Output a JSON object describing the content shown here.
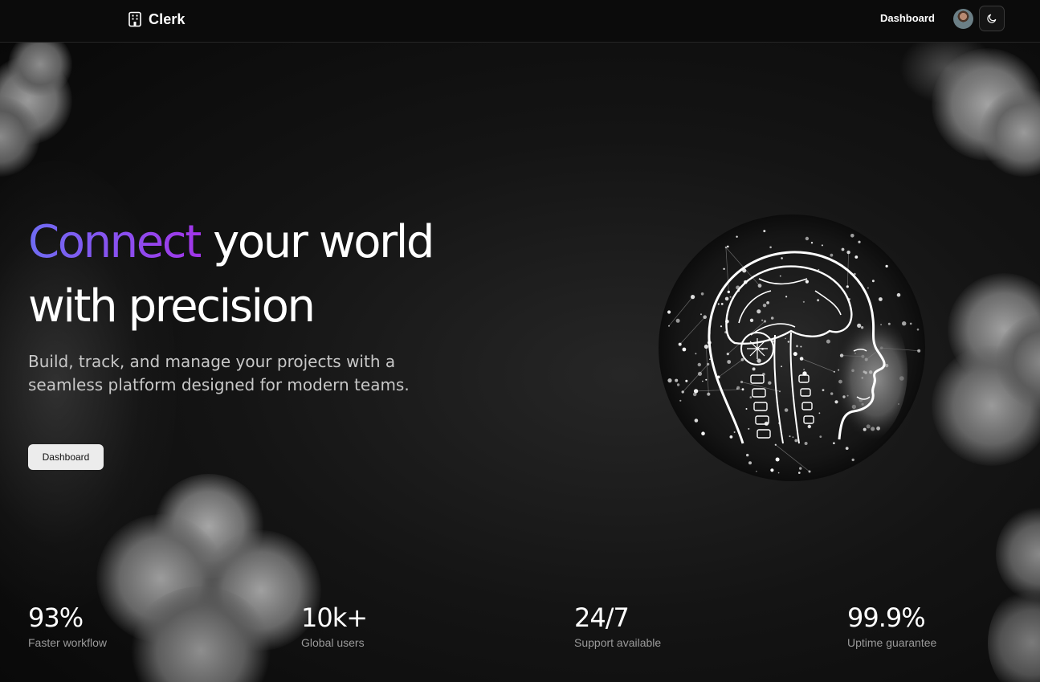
{
  "header": {
    "brand": "Clerk",
    "brand_icon": "building-icon",
    "nav_link": "Dashboard",
    "avatar_icon": "user-avatar",
    "theme_icon": "moon-icon"
  },
  "hero": {
    "title_accent": "Connect",
    "title_rest_line1": " your world",
    "title_line2": "with precision",
    "subtitle": "Build, track, and manage your projects with a seamless platform designed for modern teams.",
    "cta_label": "Dashboard",
    "accent_gradient": [
      "#6f6cf2",
      "#a235e8"
    ],
    "image_icon": "brain-network-illustration"
  },
  "stats": [
    {
      "value": "93%",
      "label": "Faster workflow"
    },
    {
      "value": "10k+",
      "label": "Global users"
    },
    {
      "value": "24/7",
      "label": "Support available"
    },
    {
      "value": "99.9%",
      "label": "Uptime guarantee"
    }
  ]
}
